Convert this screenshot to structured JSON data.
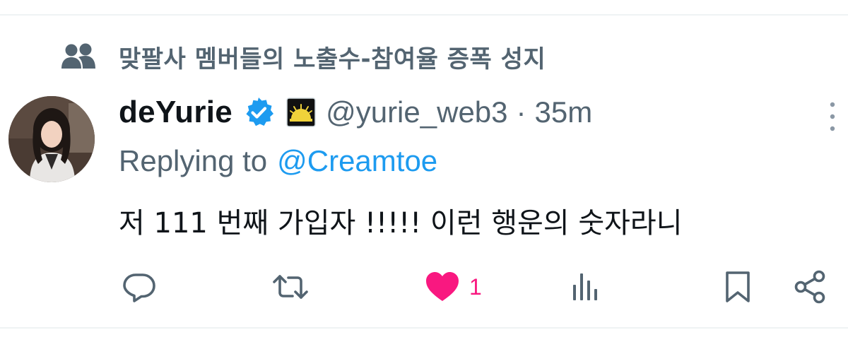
{
  "social_context": {
    "text": "맞팔사 멤버들의 노출수-참여율 증폭 성지",
    "icon": "people-icon"
  },
  "tweet": {
    "author": {
      "display_name": "deYurie",
      "handle": "@yurie_web3",
      "verified": true,
      "verified_color": "#1d9bf0",
      "affiliate_badge_icon": "sunburst-badge-icon"
    },
    "separator": "·",
    "timestamp": "35m",
    "reply_prefix": "Replying to",
    "reply_mention": "@Creamtoe",
    "body": "저 111 번째 가입자 !!!!! 이런 행운의 숫자라니"
  },
  "actions": {
    "reply_icon": "reply-icon",
    "retweet_icon": "retweet-icon",
    "like_icon": "heart-filled-icon",
    "like_count": "1",
    "like_color": "#f91880",
    "views_icon": "views-chart-icon",
    "bookmark_icon": "bookmark-icon",
    "share_icon": "share-icon"
  },
  "colors": {
    "primary_text": "#0f1419",
    "secondary_text": "#536471",
    "accent": "#1d9bf0",
    "divider": "#eff3f4"
  }
}
